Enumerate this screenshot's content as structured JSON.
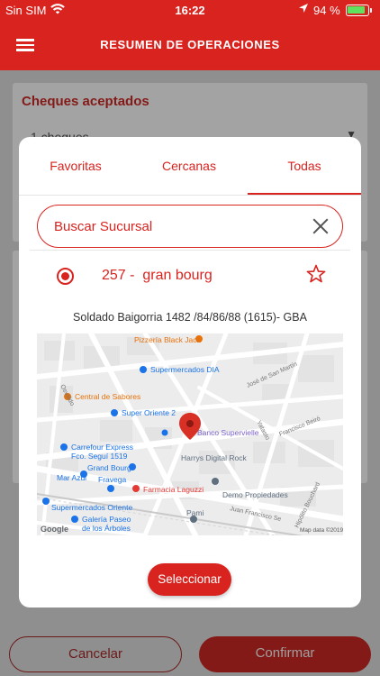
{
  "status": {
    "carrier": "Sin SIM",
    "time": "16:22",
    "battery": "94 %",
    "battery_level": 0.94
  },
  "appbar": {
    "title": "RESUMEN DE OPERACIONES"
  },
  "background": {
    "card_title": "Cheques aceptados",
    "select_value": "1 cheques"
  },
  "footer": {
    "cancel": "Cancelar",
    "confirm": "Confirmar"
  },
  "modal": {
    "tabs": [
      {
        "label": "Favoritas",
        "active": false
      },
      {
        "label": "Cercanas",
        "active": false
      },
      {
        "label": "Todas",
        "active": true
      }
    ],
    "search": {
      "value": "Buscar Sucursal",
      "placeholder": "Buscar Sucursal"
    },
    "branch": {
      "name": "257 -  gran bourg",
      "selected": true,
      "favorite": false
    },
    "address": "Soldado Baigorria 1482 /84/86/88 (1615)- GBA",
    "map": {
      "labels": {
        "pizzeria": "Pizzería Black Jack",
        "supermercados_dia": "Supermercados DIA",
        "central_sabores": "Central de Sabores",
        "super_oriente": "Super Oriente 2",
        "jose_san_martin": "José de San Martín",
        "osvaldo": "Osvaldo",
        "banco": "Banco Supervielle",
        "yatasto": "Yatasto",
        "francisco_beiro": "Francisco Beiró",
        "carrefour_1": "Carrefour Express",
        "carrefour_2": "Fco. Seguí 1519",
        "harrys": "Harrys Digital Rock",
        "grand_bourg": "Grand Bourg",
        "mar_azul": "Mar Azul",
        "fravega": "Fravega",
        "farmacia": "Farmacia Laguzzi",
        "demo": "Demo Propiedades",
        "pami": "Pami",
        "super_oriente_2": "Supermercados Oriente",
        "galeria_1": "Galería Paseo",
        "galeria_2": "de los Árboles",
        "juan_francisco": "Juan Francisco Se",
        "hipolito": "Hipólito Bouchard",
        "google": "Google",
        "attribution": "Map data ©2019"
      },
      "colors": {
        "food": "#e8710a",
        "shop": "#1a73e8",
        "pharmacy": "#e53935",
        "bank": "#7b61c9",
        "generic": "#5f6f80",
        "pin": "#d93025"
      }
    },
    "select_button": "Seleccionar"
  },
  "colors": {
    "primary": "#d9231f",
    "primary_dark": "#841a17"
  }
}
